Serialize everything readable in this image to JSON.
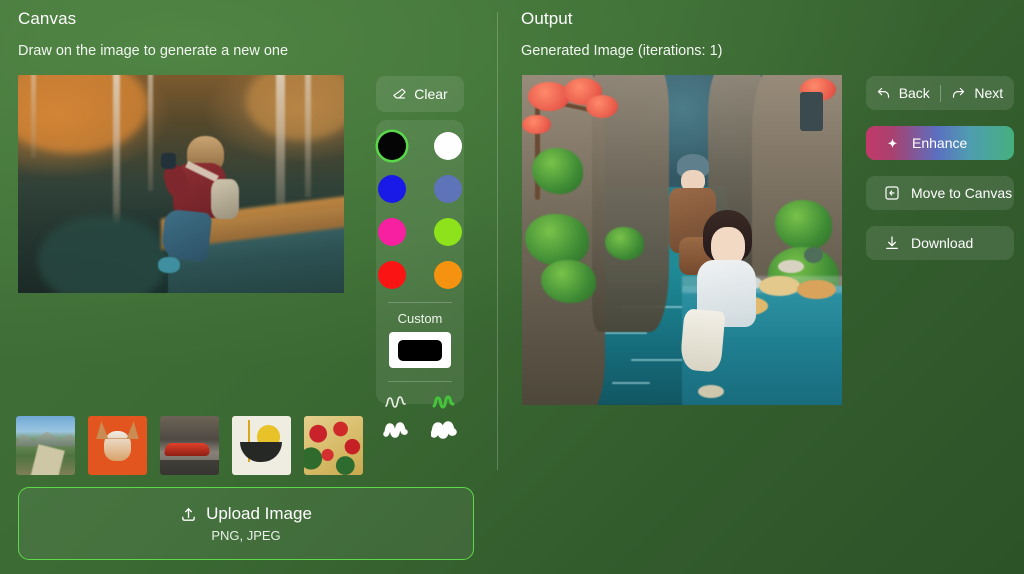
{
  "theme": {
    "background_from": "#43723a",
    "background_to": "#2c5228",
    "accent_green": "#5fd94a",
    "enhance_gradient": [
      "#c2396a",
      "#5b6fc0",
      "#45b07e"
    ]
  },
  "canvas_panel": {
    "title": "Canvas",
    "subtitle": "Draw on the image to generate a new one",
    "image_alt": "Woman in a red sweater with a camera sitting on a container in an autumn forest",
    "clear_button": {
      "label": "Clear",
      "icon": "eraser-icon"
    },
    "palette": {
      "custom_label": "Custom",
      "custom_value": "#000000",
      "selected_index": 0,
      "swatches": [
        {
          "name": "black",
          "hex": "#050505"
        },
        {
          "name": "white",
          "hex": "#ffffff"
        },
        {
          "name": "blue",
          "hex": "#1a1ae8"
        },
        {
          "name": "slate-blue",
          "hex": "#5f74b8"
        },
        {
          "name": "magenta",
          "hex": "#f720a0"
        },
        {
          "name": "lime",
          "hex": "#8de21c"
        },
        {
          "name": "red",
          "hex": "#fa1414"
        },
        {
          "name": "orange",
          "hex": "#f59310"
        }
      ],
      "brushes": [
        {
          "name": "brush-thin",
          "width": 1.6,
          "color": "#e8efe6",
          "selected": false
        },
        {
          "name": "brush-medium",
          "width": 3.0,
          "color": "#45c63a",
          "selected": true
        },
        {
          "name": "brush-thick",
          "width": 5.5,
          "color": "#ffffff",
          "selected": false
        },
        {
          "name": "brush-extra-thick",
          "width": 7.5,
          "color": "#ffffff",
          "selected": false
        }
      ]
    },
    "thumbnails": [
      {
        "name": "thumbnail-mountain-road",
        "alt": "Mountain landscape with road",
        "class": "thumb-mountain"
      },
      {
        "name": "thumbnail-corgi",
        "alt": "Corgi puppy on orange background",
        "class": "thumb-dog"
      },
      {
        "name": "thumbnail-red-car",
        "alt": "Red sports car on a street",
        "class": "thumb-car"
      },
      {
        "name": "thumbnail-abstract-sun",
        "alt": "Abstract sun and landform artwork",
        "class": "thumb-art"
      },
      {
        "name": "thumbnail-pasta",
        "alt": "Pasta with tomatoes and herbs",
        "class": "thumb-food"
      }
    ],
    "upload": {
      "label": "Upload Image",
      "formats": "PNG, JPEG",
      "icon": "upload-icon"
    }
  },
  "output_panel": {
    "title": "Output",
    "subtitle": "Generated Image (iterations: 1)",
    "iterations": 1,
    "image_alt": "Anime-style illustration of a girl at a table beside a canal between cliffs",
    "actions": [
      {
        "name": "back-button",
        "label": "Back",
        "icon": "undo-arrow-icon"
      },
      {
        "name": "next-button",
        "label": "Next",
        "icon": "redo-arrow-icon"
      },
      {
        "name": "enhance-button",
        "label": "Enhance",
        "icon": "sparkle-icon"
      },
      {
        "name": "move-to-canvas-button",
        "label": "Move to Canvas",
        "icon": "arrow-left-box-icon"
      },
      {
        "name": "download-button",
        "label": "Download",
        "icon": "download-icon"
      }
    ]
  }
}
